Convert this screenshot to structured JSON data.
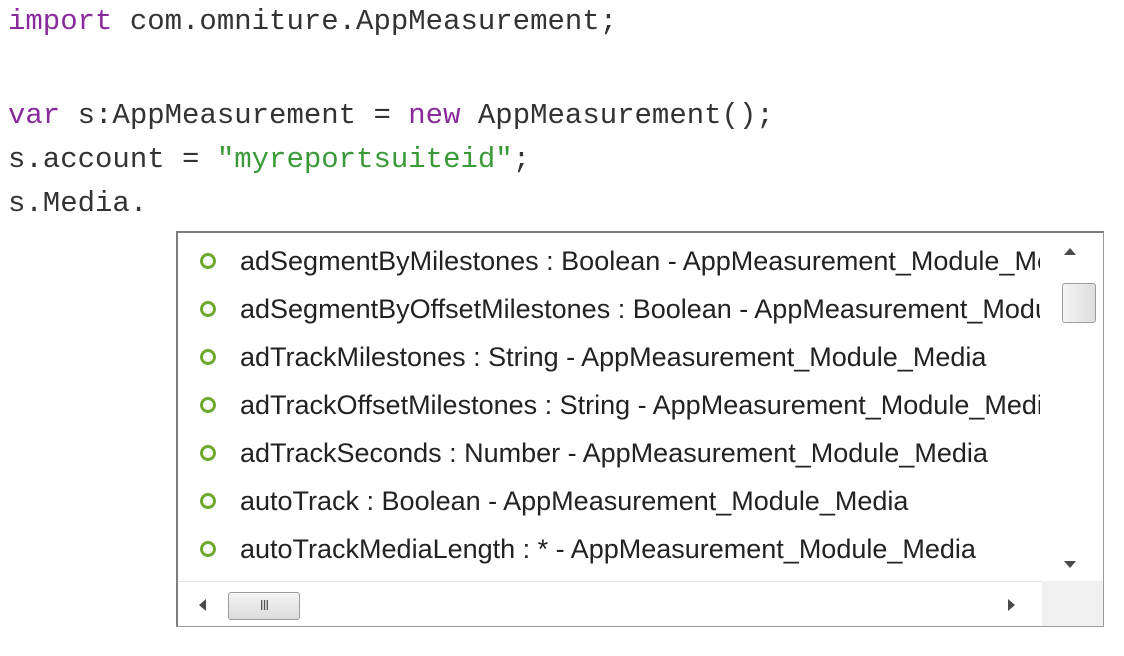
{
  "code": {
    "line1": {
      "keyword": "import",
      "rest": " com.omniture.AppMeasurement;"
    },
    "line2": {
      "keyword": "var",
      "mid": " s:AppMeasurement = ",
      "keyword2": "new",
      "rest": " AppMeasurement();"
    },
    "line3": {
      "prefix": "s.account = ",
      "string": "\"myreportsuiteid\"",
      "suffix": ";"
    },
    "line4": {
      "text": "s.Media."
    }
  },
  "autocomplete": {
    "items": [
      {
        "label": "adSegmentByMilestones : Boolean - AppMeasurement_Module_Media"
      },
      {
        "label": "adSegmentByOffsetMilestones : Boolean - AppMeasurement_Module_Media"
      },
      {
        "label": "adTrackMilestones : String - AppMeasurement_Module_Media"
      },
      {
        "label": "adTrackOffsetMilestones : String - AppMeasurement_Module_Media"
      },
      {
        "label": "adTrackSeconds : Number - AppMeasurement_Module_Media"
      },
      {
        "label": "autoTrack : Boolean - AppMeasurement_Module_Media"
      },
      {
        "label": "autoTrackMediaLength : * - AppMeasurement_Module_Media"
      }
    ],
    "bullet_color": "#6fa82e",
    "hscroll_grip": "III"
  },
  "colors": {
    "keyword": "#8a2b9b",
    "string": "#3a9a3a",
    "text": "#333333"
  }
}
